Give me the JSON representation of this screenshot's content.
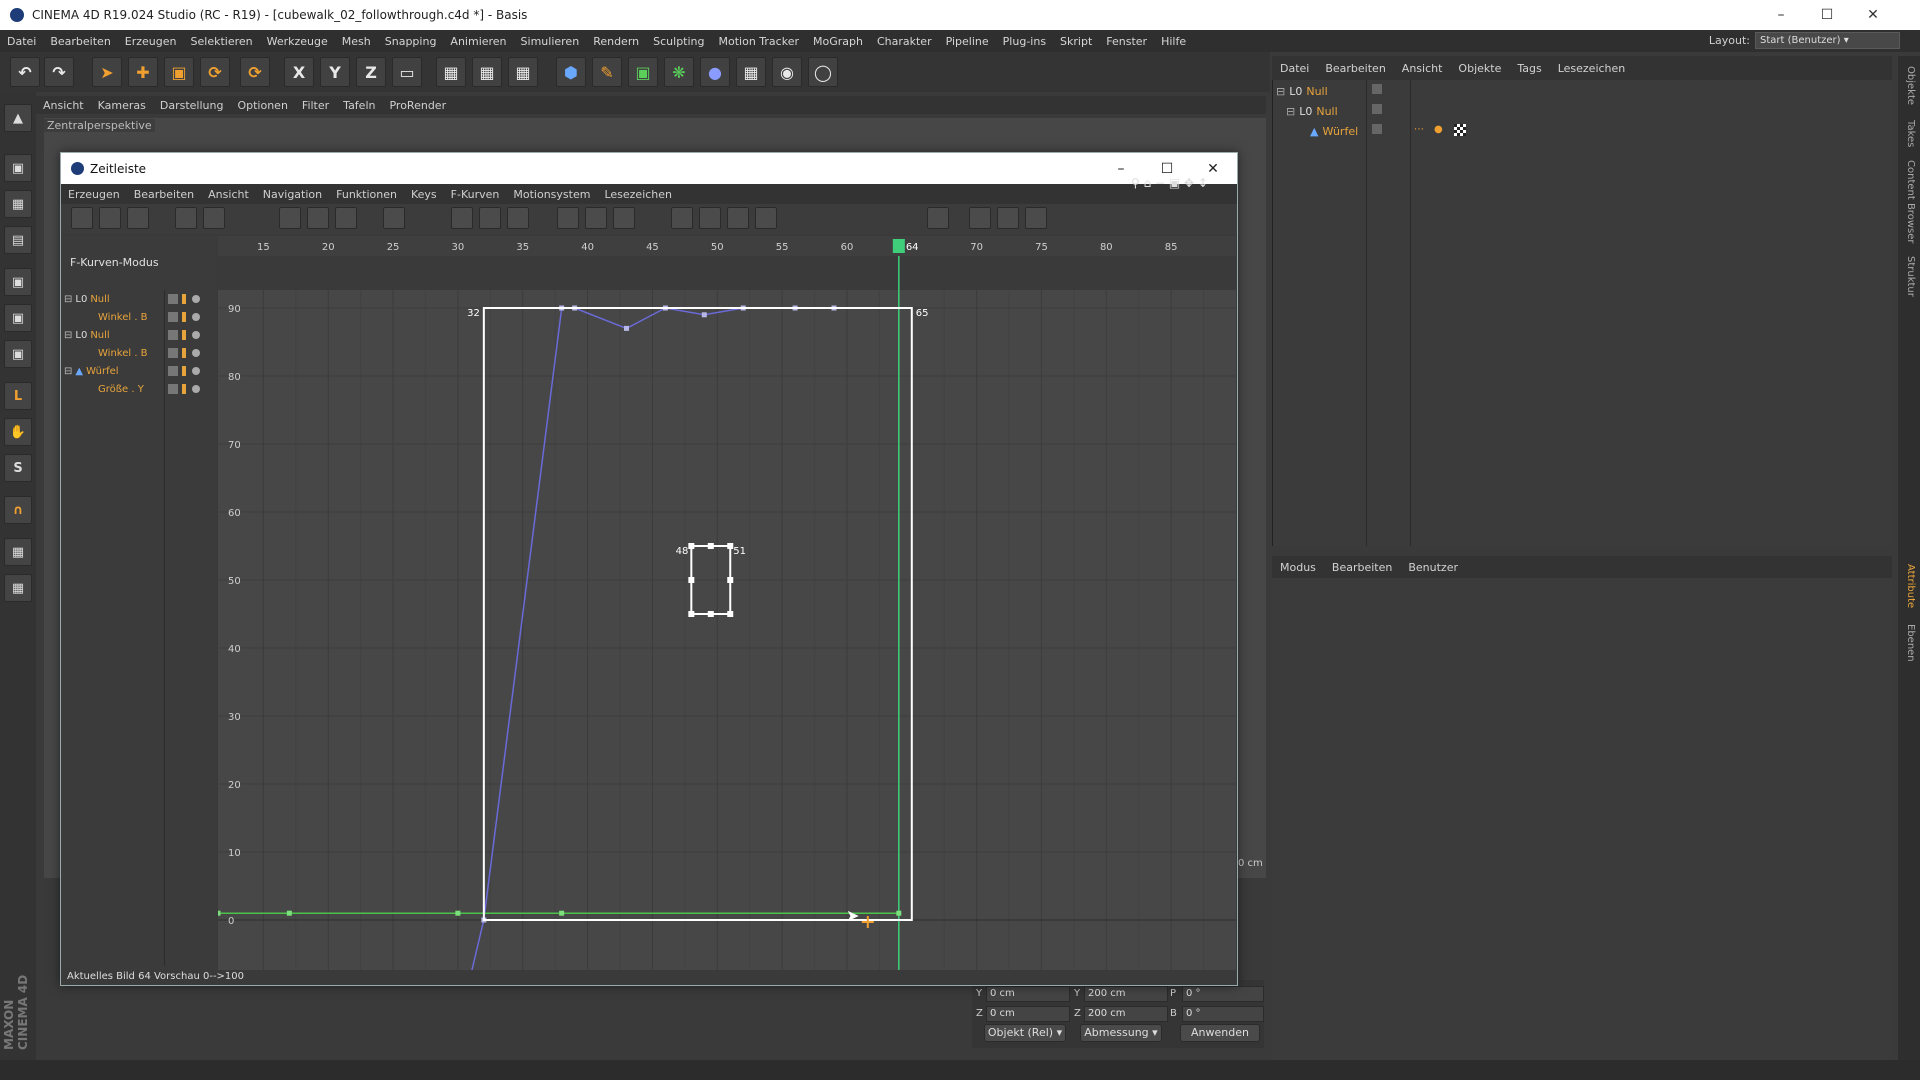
{
  "app": {
    "window_title": "CINEMA 4D R19.024 Studio (RC - R19) - [cubewalk_02_followthrough.c4d *] - Basis",
    "menu": [
      "Datei",
      "Bearbeiten",
      "Erzeugen",
      "Selektieren",
      "Werkzeuge",
      "Mesh",
      "Snapping",
      "Animieren",
      "Simulieren",
      "Rendern",
      "Sculpting",
      "Motion Tracker",
      "MoGraph",
      "Charakter",
      "Pipeline",
      "Plug-ins",
      "Skript",
      "Fenster",
      "Hilfe"
    ],
    "layout_label": "Layout:",
    "layout_value": "Start (Benutzer)"
  },
  "toolbar": {
    "axis_x": "X",
    "axis_y": "Y",
    "axis_z": "Z"
  },
  "viewport": {
    "menu": [
      "Ansicht",
      "Kameras",
      "Darstellung",
      "Optionen",
      "Filter",
      "Tafeln",
      "ProRender"
    ],
    "label": "Zentralperspektive"
  },
  "object_manager": {
    "menu": [
      "Datei",
      "Bearbeiten",
      "Ansicht",
      "Objekte",
      "Tags",
      "Lesezeichen"
    ],
    "objects": [
      {
        "name": "Null",
        "indent": 0
      },
      {
        "name": "Null",
        "indent": 1
      },
      {
        "name": "Würfel",
        "indent": 2
      }
    ]
  },
  "attribute_manager": {
    "menu": [
      "Modus",
      "Bearbeiten",
      "Benutzer"
    ]
  },
  "side_tabs": [
    "Objekte",
    "Takes",
    "Content Browser",
    "Struktur",
    "Attribute",
    "Ebenen"
  ],
  "coordinates": {
    "unit_label": "0 cm",
    "rows": [
      {
        "a_label": "Y",
        "a_value": "0 cm",
        "b_label": "Y",
        "b_value": "200 cm",
        "c_label": "P",
        "c_value": "0 °"
      },
      {
        "a_label": "Z",
        "a_value": "0 cm",
        "b_label": "Z",
        "b_value": "200 cm",
        "c_label": "B",
        "c_value": "0 °"
      }
    ],
    "mode_select": "Objekt (Rel)",
    "size_select": "Abmessung",
    "apply_button": "Anwenden"
  },
  "maxon_logo": "MAXON CINEMA 4D",
  "timeline": {
    "title": "Zeitleiste",
    "menu": [
      "Erzeugen",
      "Bearbeiten",
      "Ansicht",
      "Navigation",
      "Funktionen",
      "Keys",
      "F-Kurven",
      "Motionsystem",
      "Lesezeichen"
    ],
    "mode": "F-Kurven-Modus",
    "tracks": [
      {
        "name": "Null",
        "type": "object"
      },
      {
        "name": "Winkel . B",
        "type": "track"
      },
      {
        "name": "Null",
        "type": "object"
      },
      {
        "name": "Winkel . B",
        "type": "track"
      },
      {
        "name": "Würfel",
        "type": "object"
      },
      {
        "name": "Größe . Y",
        "type": "track"
      }
    ],
    "ruler_ticks": [
      "15",
      "20",
      "25",
      "30",
      "35",
      "40",
      "45",
      "50",
      "55",
      "60",
      "64",
      "70",
      "75",
      "80",
      "85"
    ],
    "current_frame": "64",
    "y_ticks": [
      "90",
      "80",
      "70",
      "60",
      "50",
      "40",
      "30",
      "20",
      "10",
      "0"
    ],
    "selection_labels": {
      "left": "32",
      "right": "65"
    },
    "inner_labels": {
      "left": "48",
      "right": "51"
    },
    "status": "Aktuelles Bild  64  Vorschau  0-->100"
  },
  "chart_data": {
    "type": "line",
    "xlabel": "",
    "ylabel": "",
    "xlim": [
      11.5,
      90
    ],
    "ylim": [
      -5,
      95
    ],
    "current_frame": 64,
    "series": [
      {
        "color": "#6a6ad8",
        "x": [
          31,
          32,
          38,
          39,
          43,
          46,
          49,
          52,
          56,
          59
        ],
        "y": [
          -8,
          0,
          90,
          90,
          87,
          90,
          89,
          90,
          90,
          90
        ]
      },
      {
        "color": "#4cc24c",
        "x": [
          11.5,
          17,
          30,
          38,
          64
        ],
        "y": [
          1,
          1,
          1,
          1,
          1
        ]
      }
    ],
    "selection_frames": [
      32,
      65
    ],
    "inner_selection_frames": [
      48,
      51
    ]
  }
}
